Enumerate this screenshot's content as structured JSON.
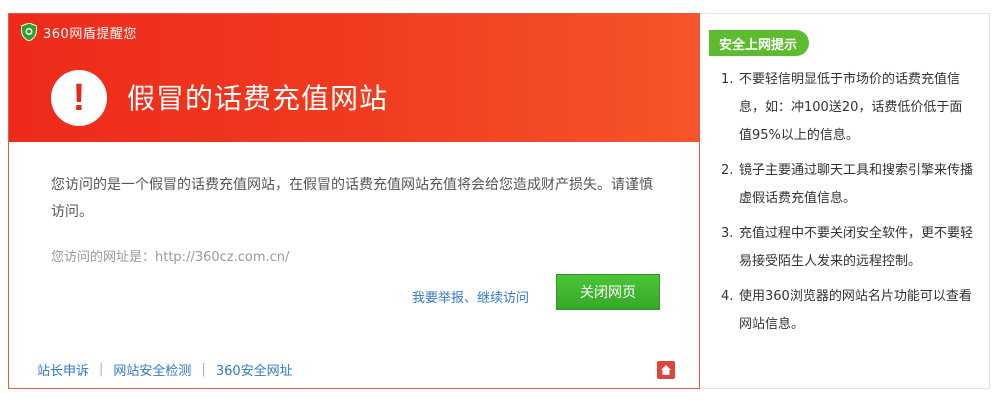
{
  "brand": {
    "name": "360网盾提醒您"
  },
  "warning": {
    "title": "假冒的话费充值网站",
    "description": "您访问的是一个假冒的话费充值网站，在假冒的话费充值网站充值将会给您造成财产损失。请谨慎访问。",
    "url_line": "您访问的网址是：http://360cz.com.cn/"
  },
  "actions": {
    "ignore_label": "我要举报",
    "separator": "、",
    "continue_label": "继续访问",
    "close_label": "关闭网页"
  },
  "footer": {
    "links": [
      "站长申诉",
      "网站安全检测",
      "360安全网址"
    ],
    "separator": "|"
  },
  "tips": {
    "heading": "安全上网提示",
    "items": [
      {
        "num": "1.",
        "text": "不要轻信明显低于市场价的话费充值信息，如：冲100送20，话费低价低于面值95%以上的信息。"
      },
      {
        "num": "2.",
        "text": "镜子主要通过聊天工具和搜索引擎来传播虚假话费充值信息。"
      },
      {
        "num": "3.",
        "text": "充值过程中不要关闭安全软件，更不要轻易接受陌生人发来的远程控制。"
      },
      {
        "num": "4.",
        "text": "使用360浏览器的网站名片功能可以查看网站信息。"
      }
    ]
  },
  "colors": {
    "banner": "#ee2a1a",
    "accent_green": "#5cbb2e",
    "link_blue": "#2f7bc9"
  },
  "icons": {
    "brand": "shield-icon",
    "alert": "exclamation-icon",
    "report": "report-icon"
  }
}
